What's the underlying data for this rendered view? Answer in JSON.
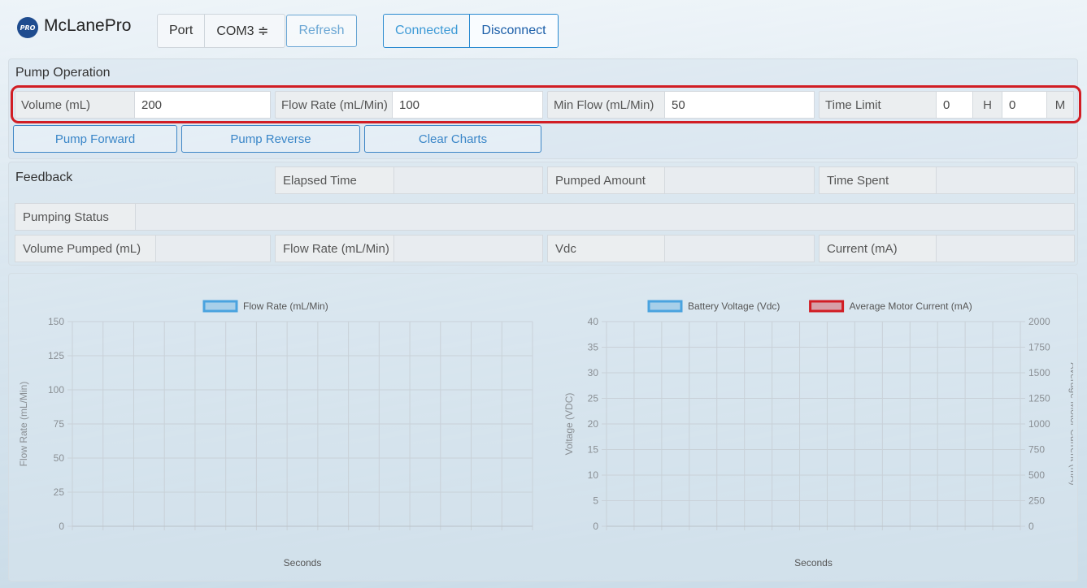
{
  "header": {
    "logo_badge": "PRO",
    "app_name": "McLanePro",
    "port_label": "Port",
    "port_value": "COM3 ≑",
    "refresh_label": "Refresh",
    "connected_label": "Connected",
    "disconnect_label": "Disconnect"
  },
  "pump": {
    "title": "Pump Operation",
    "volume_label": "Volume (mL)",
    "volume_value": "200",
    "flow_rate_label": "Flow Rate (mL/Min)",
    "flow_rate_value": "100",
    "min_flow_label": "Min Flow (mL/Min)",
    "min_flow_value": "50",
    "time_limit_label": "Time Limit",
    "hours_value": "0",
    "hours_unit": "H",
    "minutes_value": "0",
    "minutes_unit": "M",
    "pump_forward_label": "Pump Forward",
    "pump_reverse_label": "Pump Reverse",
    "clear_charts_label": "Clear Charts",
    "highlight_color": "#d11d24"
  },
  "feedback": {
    "title": "Feedback",
    "elapsed_time_label": "Elapsed Time",
    "elapsed_time_value": "",
    "pumped_amount_label": "Pumped Amount",
    "pumped_amount_value": "",
    "time_spent_label": "Time Spent",
    "time_spent_value": "",
    "pumping_status_label": "Pumping Status",
    "pumping_status_value": "",
    "volume_pumped_label": "Volume Pumped (mL)",
    "volume_pumped_value": "",
    "flow_rate_label": "Flow Rate (mL/Min)",
    "flow_rate_value": "",
    "vdc_label": "Vdc",
    "vdc_value": "",
    "current_label": "Current (mA)",
    "current_value": ""
  },
  "chart_data": [
    {
      "type": "line",
      "title": "",
      "xlabel": "Seconds",
      "ylabel": "Flow Rate (mL/Min)",
      "ylim": [
        0,
        150
      ],
      "yticks": [
        0,
        25,
        50,
        75,
        100,
        125,
        150
      ],
      "x_gridlines": 15,
      "grid": true,
      "legend_position": "top",
      "series": [
        {
          "name": "Flow Rate (mL/Min)",
          "color": "#4aa3df",
          "values": []
        }
      ]
    },
    {
      "type": "line",
      "title": "",
      "xlabel": "Seconds",
      "ylabel": "Voltage (VDC)",
      "ylabel_right": "Average Motor Current (mA)",
      "ylim": [
        0,
        40
      ],
      "ylim_right": [
        0,
        2000
      ],
      "yticks": [
        0,
        5,
        10,
        15,
        20,
        25,
        30,
        35,
        40
      ],
      "yticks_right": [
        0,
        250,
        500,
        750,
        1000,
        1250,
        1500,
        1750,
        2000
      ],
      "x_gridlines": 15,
      "grid": true,
      "legend_position": "top",
      "series": [
        {
          "name": "Battery Voltage (Vdc)",
          "color": "#4aa3df",
          "values": []
        },
        {
          "name": "Average Motor Current (mA)",
          "color": "#d11d24",
          "values": []
        }
      ]
    }
  ]
}
